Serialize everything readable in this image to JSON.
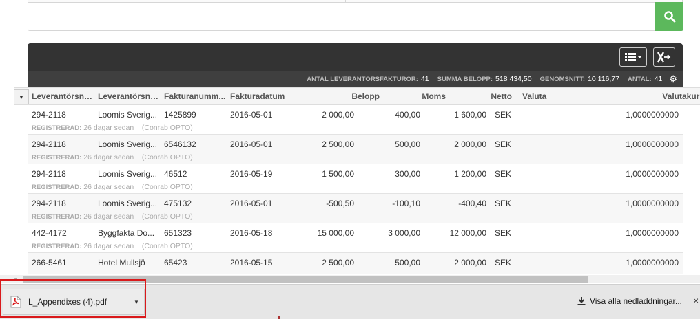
{
  "search": {
    "placeholder": "",
    "value": ""
  },
  "toolbar": {
    "view_button": "list-view",
    "export_button": "excel-export"
  },
  "summary": [
    {
      "label": "ANTAL LEVERANTÖRSFAKTUROR:",
      "value": "41"
    },
    {
      "label": "SUMMA BELOPP:",
      "value": "518 434,50"
    },
    {
      "label": "GENOMSNITT:",
      "value": "10 116,77"
    },
    {
      "label": "ANTAL:",
      "value": "41"
    }
  ],
  "columns": [
    "Leverantörsnummer",
    "Leverantörsnamn",
    "Fakturanummer",
    "Fakturadatum",
    "Belopp",
    "Moms",
    "Netto",
    "Valuta",
    "Valutakurs"
  ],
  "columns_display": [
    "Leverantörsnu...",
    "Leverantörsna...",
    "Fakturanumm...",
    "Fakturadatum",
    "Belopp",
    "Moms",
    "Netto",
    "Valuta",
    "Valutakurs"
  ],
  "rows": [
    {
      "supplier_no": "294-2118",
      "supplier_name": "Loomis Sverig...",
      "invoice_no": "1425899",
      "date": "2016-05-01",
      "amount": "2 000,00",
      "vat": "400,00",
      "net": "1 600,00",
      "currency": "SEK",
      "rate": "1,0000000000",
      "reg_label": "REGISTRERAD:",
      "reg_when": "26 dagar sedan",
      "reg_by": "(Conrab OPTO)"
    },
    {
      "supplier_no": "294-2118",
      "supplier_name": "Loomis Sverig...",
      "invoice_no": "6546132",
      "date": "2016-05-01",
      "amount": "2 500,00",
      "vat": "500,00",
      "net": "2 000,00",
      "currency": "SEK",
      "rate": "1,0000000000",
      "reg_label": "REGISTRERAD:",
      "reg_when": "26 dagar sedan",
      "reg_by": "(Conrab OPTO)"
    },
    {
      "supplier_no": "294-2118",
      "supplier_name": "Loomis Sverig...",
      "invoice_no": "46512",
      "date": "2016-05-19",
      "amount": "1 500,00",
      "vat": "300,00",
      "net": "1 200,00",
      "currency": "SEK",
      "rate": "1,0000000000",
      "reg_label": "REGISTRERAD:",
      "reg_when": "26 dagar sedan",
      "reg_by": "(Conrab OPTO)"
    },
    {
      "supplier_no": "294-2118",
      "supplier_name": "Loomis Sverig...",
      "invoice_no": "475132",
      "date": "2016-05-01",
      "amount": "-500,50",
      "vat": "-100,10",
      "net": "-400,40",
      "currency": "SEK",
      "rate": "1,0000000000",
      "reg_label": "REGISTRERAD:",
      "reg_when": "26 dagar sedan",
      "reg_by": "(Conrab OPTO)"
    },
    {
      "supplier_no": "442-4172",
      "supplier_name": "Byggfakta Do...",
      "invoice_no": "651323",
      "date": "2016-05-18",
      "amount": "15 000,00",
      "vat": "3 000,00",
      "net": "12 000,00",
      "currency": "SEK",
      "rate": "1,0000000000",
      "reg_label": "REGISTRERAD:",
      "reg_when": "26 dagar sedan",
      "reg_by": "(Conrab OPTO)"
    },
    {
      "supplier_no": "266-5461",
      "supplier_name": "Hotel Mullsjö",
      "invoice_no": "65423",
      "date": "2016-05-15",
      "amount": "2 500,00",
      "vat": "500,00",
      "net": "2 000,00",
      "currency": "SEK",
      "rate": "1,0000000000",
      "reg_label": "",
      "reg_when": "",
      "reg_by": ""
    }
  ],
  "download_bar": {
    "file_name": "L_Appendixes (4).pdf",
    "show_all": "Visa alla nedladdningar...",
    "close": "×"
  },
  "colors": {
    "toolbar": "#333333",
    "summary": "#3f3f3f",
    "search_button": "#5cb85c",
    "highlight": "#d9191b"
  }
}
